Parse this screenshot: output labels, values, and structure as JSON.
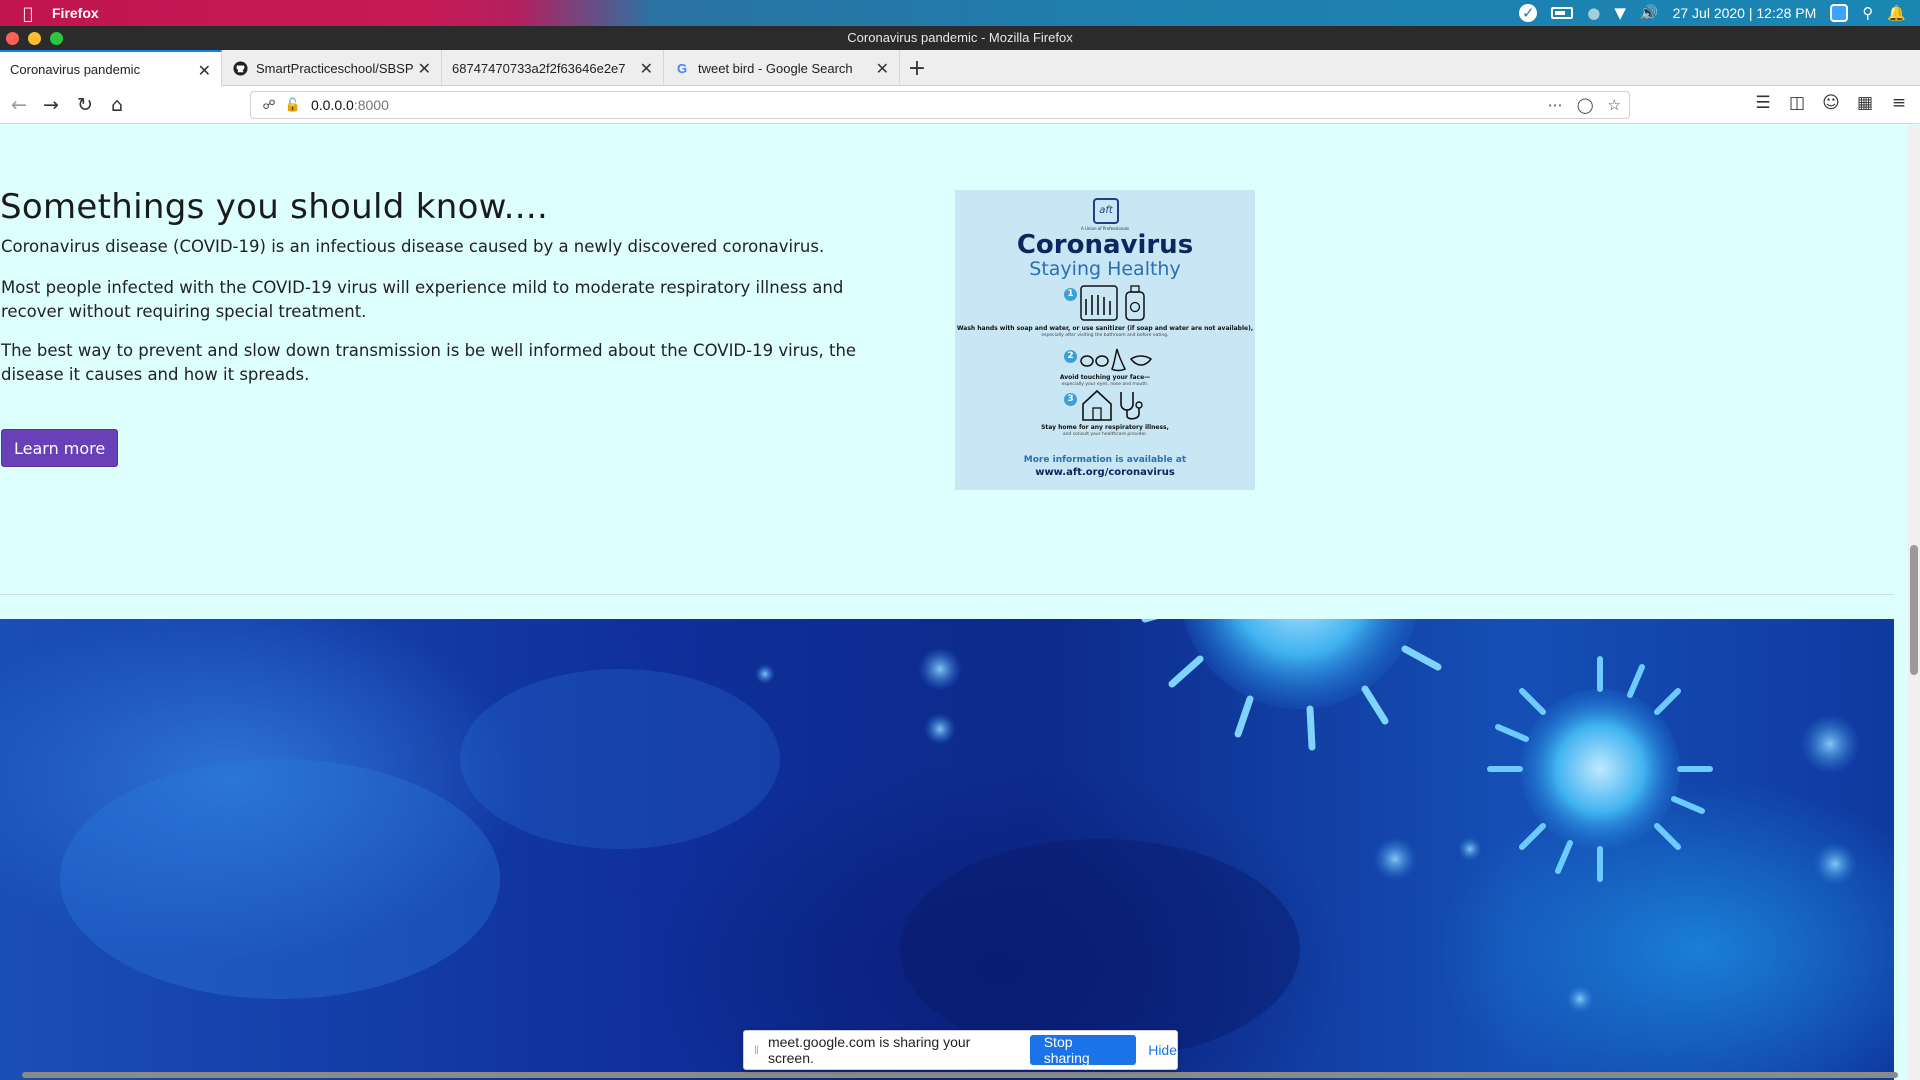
{
  "menubar": {
    "app_name": "Firefox",
    "clock": "27 Jul 2020 | 12:28 PM",
    "accent_gradient_start": "#c0154f",
    "accent_gradient_end": "#1a86b4"
  },
  "window": {
    "title": "Coronavirus pandemic - Mozilla Firefox"
  },
  "tabs": [
    {
      "label": "Coronavirus pandemic",
      "icon": "none",
      "active": true
    },
    {
      "label": "SmartPracticeschool/SBSP",
      "icon": "github-icon",
      "active": false
    },
    {
      "label": "68747470733a2f2f63646e2e7",
      "icon": "none",
      "active": false
    },
    {
      "label": "tweet bird - Google Search",
      "icon": "google-icon",
      "active": false
    }
  ],
  "address_bar": {
    "host": "0.0.0.0",
    "port": ":8000"
  },
  "page": {
    "heading": "Somethings you should know....",
    "paragraphs": [
      "Coronavirus disease (COVID-19) is an infectious disease caused by a newly discovered coronavirus.",
      "Most people infected with the COVID-19 virus will experience mild to moderate respiratory illness and recover without requiring special treatment.",
      "The best way to prevent and slow down transmission is be well informed about the COVID-19 virus, the disease it causes and how it spreads."
    ],
    "learn_more_label": "Learn more",
    "button_color": "#6a40b9",
    "background_color": "#ddfffe"
  },
  "poster": {
    "logo_text": "aft",
    "tagline": "A Union of Professionals",
    "title": "Coronavirus",
    "subtitle": "Staying Healthy",
    "steps": [
      {
        "num": "1",
        "text": "Wash hands with soap and water, or use sanitizer (if soap and water are not available),",
        "detail": "especially after visiting the bathroom and before eating."
      },
      {
        "num": "2",
        "text": "Avoid touching your face—",
        "detail": "especially your eyes, nose and mouth."
      },
      {
        "num": "3",
        "text": "Stay home for any respiratory illness,",
        "detail": "and consult your healthcare provider."
      }
    ],
    "more_info": "More information is available at",
    "more_url": "www.aft.org/coronavirus"
  },
  "sharing_bar": {
    "message": "meet.google.com is sharing your screen.",
    "stop_label": "Stop sharing",
    "hide_label": "Hide"
  }
}
